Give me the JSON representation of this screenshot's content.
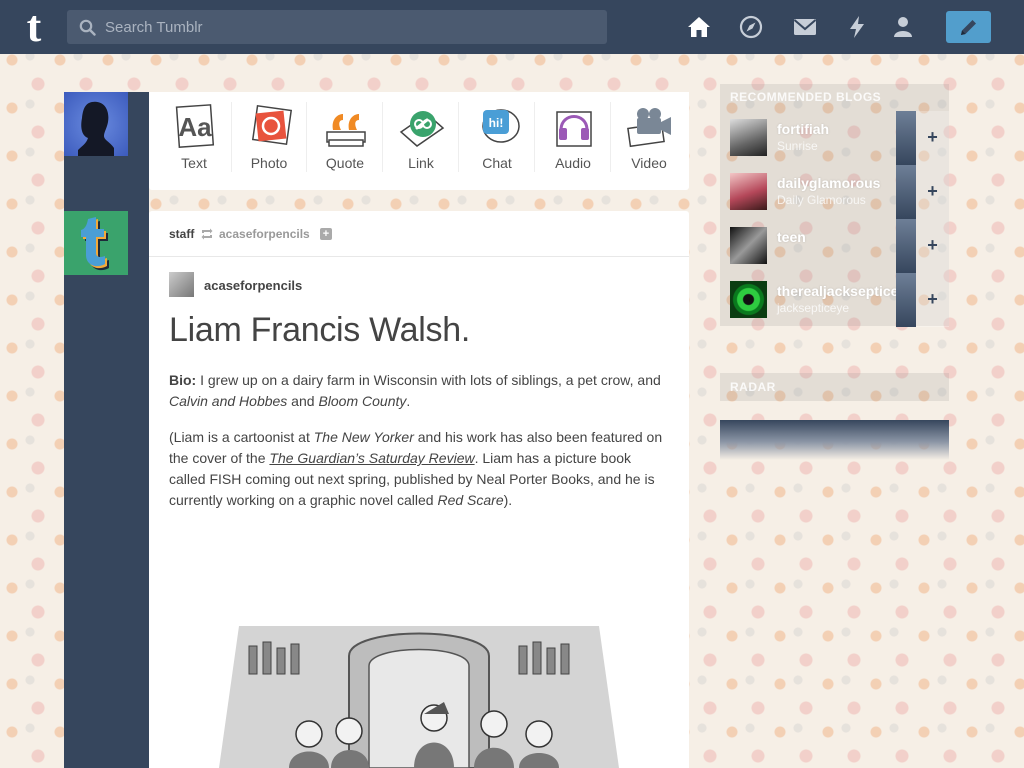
{
  "header": {
    "logo": "t",
    "search_placeholder": "Search Tumblr"
  },
  "post_types": [
    {
      "label": "Text",
      "icon": "text-icon"
    },
    {
      "label": "Photo",
      "icon": "photo-icon"
    },
    {
      "label": "Quote",
      "icon": "quote-icon"
    },
    {
      "label": "Link",
      "icon": "link-icon"
    },
    {
      "label": "Chat",
      "icon": "chat-icon"
    },
    {
      "label": "Audio",
      "icon": "audio-icon"
    },
    {
      "label": "Video",
      "icon": "video-icon"
    }
  ],
  "post": {
    "user": "staff",
    "reblog_source": "acaseforpencils",
    "source_name": "acaseforpencils",
    "title": "Liam Francis Walsh.",
    "bio_label": "Bio:",
    "bio_text": " I grew up on a dairy farm in Wisconsin with lots of siblings, a pet crow, and ",
    "bio_em1": "Calvin and Hobbes",
    "bio_and": " and ",
    "bio_em2": "Bloom County",
    "bio_end": ".",
    "p2_a": "(Liam is a cartoonist at ",
    "p2_em1": "The New Yorker",
    "p2_b": " and his work has also been featured on the cover of the ",
    "p2_link": "The Guardian’s Saturday Review",
    "p2_c": ". Liam has a picture book called FISH coming out next spring, published by Neal Porter Books, and he is currently working on a graphic novel called ",
    "p2_em2": "Red Scare",
    "p2_d": ")."
  },
  "recommended": {
    "title": "RECOMMENDED BLOGS",
    "items": [
      {
        "name": "fortifiah",
        "sub": "Sunrise"
      },
      {
        "name": "dailyglamorous",
        "sub": "Daily Glamorous"
      },
      {
        "name": "teen",
        "sub": ""
      },
      {
        "name": "therealjacksepticeye",
        "sub": "jacksepticeye"
      }
    ]
  },
  "radar": {
    "title": "RADAR"
  },
  "colors": {
    "navy": "#36465d",
    "blue": "#529ecc"
  }
}
